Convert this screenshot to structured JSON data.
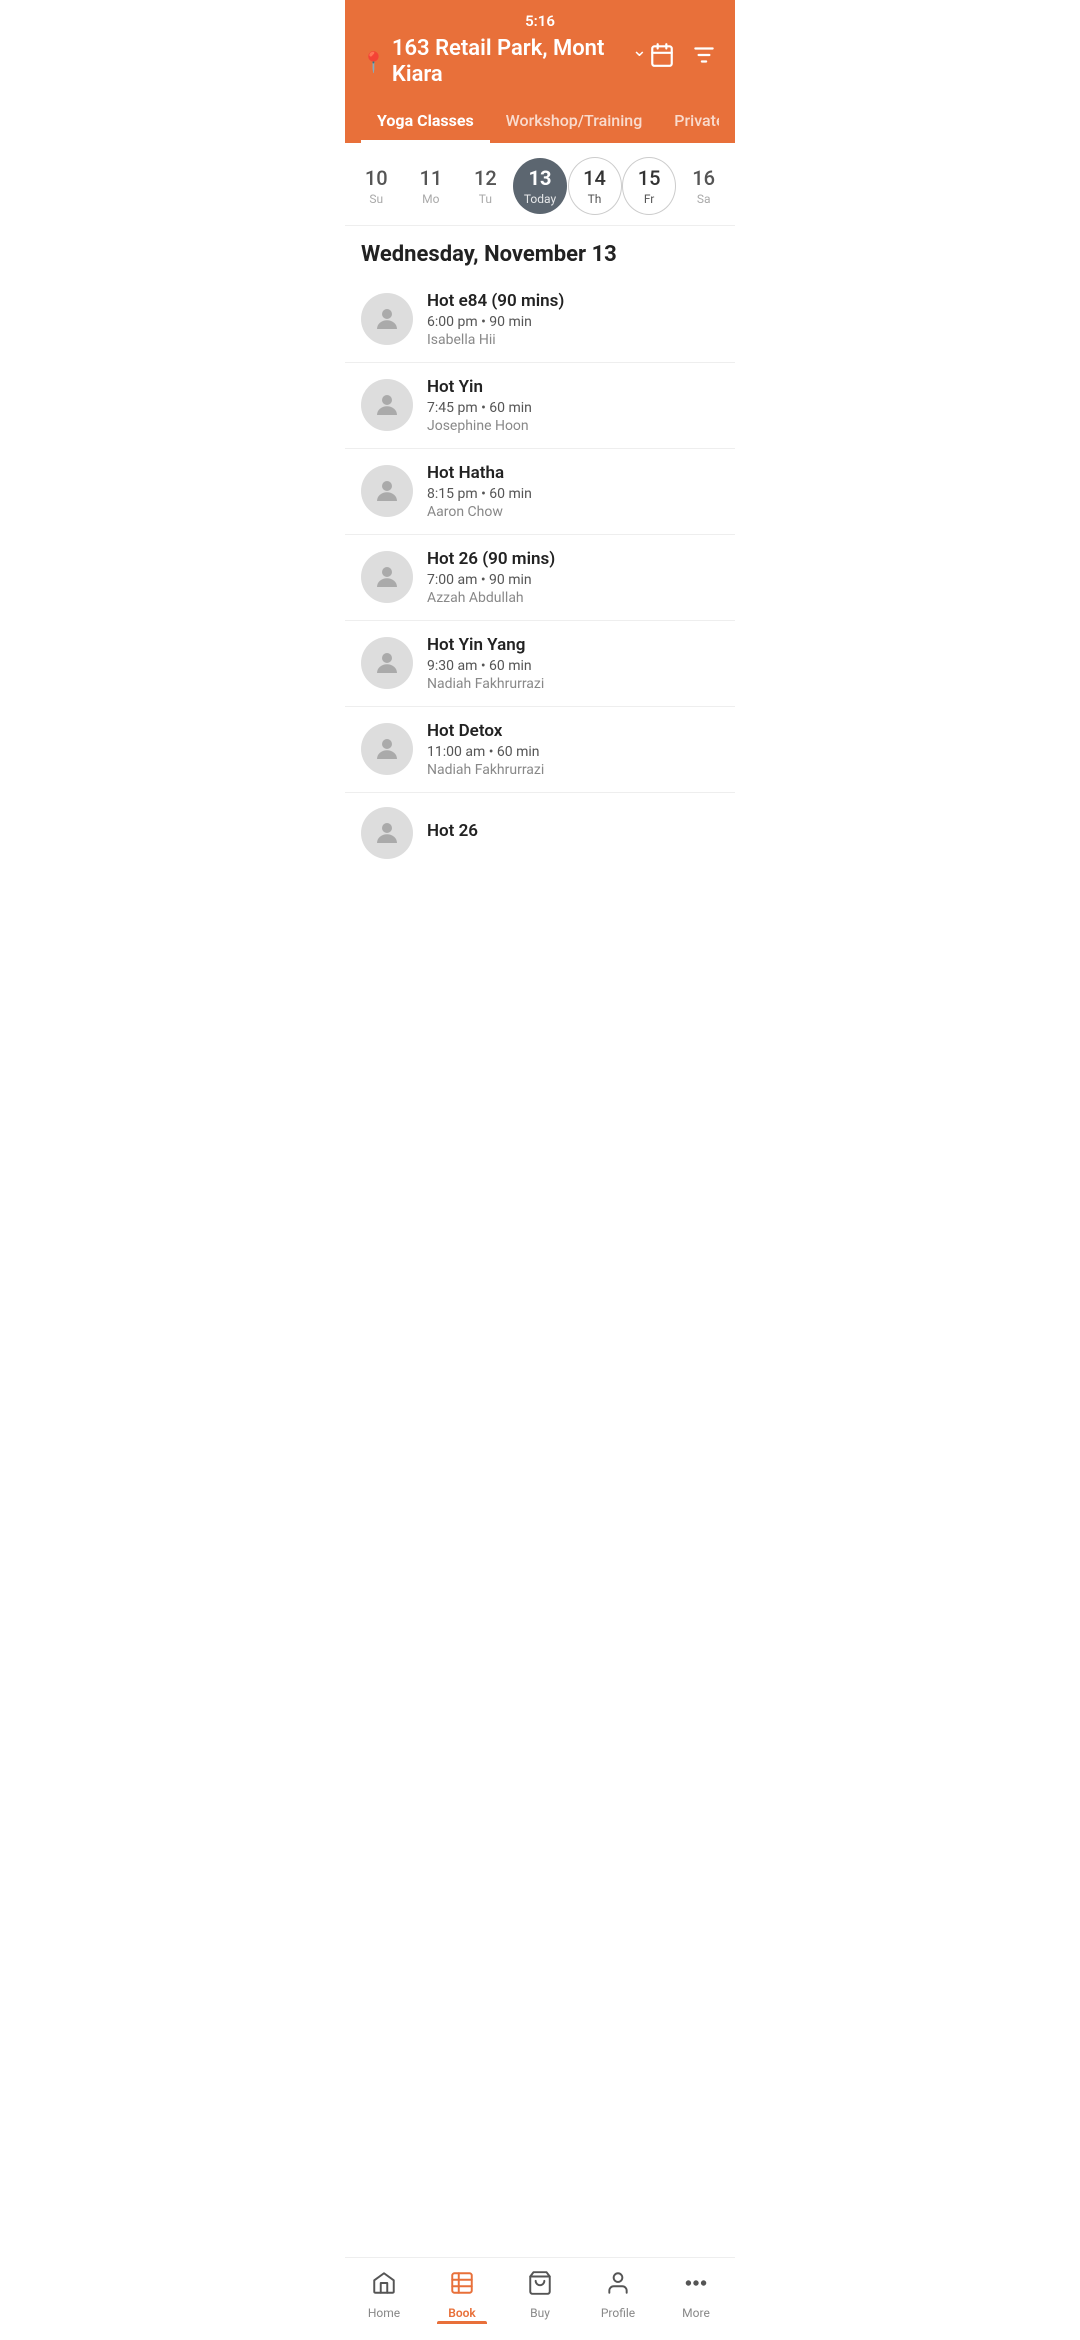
{
  "status_bar": {
    "time": "5:16"
  },
  "header": {
    "location": "163 Retail Park, Mont Kiara",
    "calendar_icon": "calendar-icon",
    "filter_icon": "filter-icon"
  },
  "category_tabs": [
    {
      "id": "yoga",
      "label": "Yoga Classes",
      "active": true
    },
    {
      "id": "workshop",
      "label": "Workshop/Training",
      "active": false
    },
    {
      "id": "private",
      "label": "Private Se...",
      "active": false
    }
  ],
  "date_picker": {
    "dates": [
      {
        "num": "10",
        "day": "Su",
        "state": "normal"
      },
      {
        "num": "11",
        "day": "Mo",
        "state": "normal"
      },
      {
        "num": "12",
        "day": "Tu",
        "state": "normal"
      },
      {
        "num": "13",
        "day": "Today",
        "state": "active"
      },
      {
        "num": "14",
        "day": "Th",
        "state": "outlined"
      },
      {
        "num": "15",
        "day": "Fr",
        "state": "outlined"
      },
      {
        "num": "16",
        "day": "Sa",
        "state": "normal"
      }
    ]
  },
  "day_header": "Wednesday, November 13",
  "classes": [
    {
      "id": 1,
      "name": "Hot e84 (90 mins)",
      "time": "6:00 pm • 90 min",
      "instructor": "Isabella Hii"
    },
    {
      "id": 2,
      "name": "Hot Yin",
      "time": "7:45 pm • 60 min",
      "instructor": "Josephine Hoon"
    },
    {
      "id": 3,
      "name": "Hot Hatha",
      "time": "8:15 pm • 60 min",
      "instructor": "Aaron Chow"
    },
    {
      "id": 4,
      "name": "Hot 26 (90 mins)",
      "time": "7:00 am • 90 min",
      "instructor": "Azzah Abdullah"
    },
    {
      "id": 5,
      "name": "Hot Yin Yang",
      "time": "9:30 am • 60 min",
      "instructor": "Nadiah Fakhrurrazi"
    },
    {
      "id": 6,
      "name": "Hot Detox",
      "time": "11:00 am • 60 min",
      "instructor": "Nadiah Fakhrurrazi"
    },
    {
      "id": 7,
      "name": "Hot 26",
      "time": "",
      "instructor": ""
    }
  ],
  "bottom_nav": {
    "items": [
      {
        "id": "home",
        "label": "Home",
        "active": false
      },
      {
        "id": "book",
        "label": "Book",
        "active": true
      },
      {
        "id": "buy",
        "label": "Buy",
        "active": false
      },
      {
        "id": "profile",
        "label": "Profile",
        "active": false
      },
      {
        "id": "more",
        "label": "More",
        "active": false
      }
    ]
  }
}
